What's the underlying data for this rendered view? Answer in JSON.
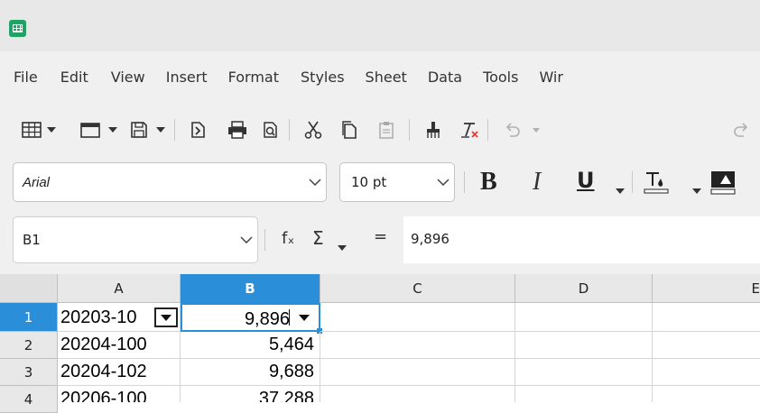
{
  "menu": [
    "File",
    "Edit",
    "View",
    "Insert",
    "Format",
    "Styles",
    "Sheet",
    "Data",
    "Tools",
    "Wir"
  ],
  "toolbar": {
    "icons": [
      "table-icon",
      "new-document-icon",
      "save-icon",
      "open-template-icon",
      "print-icon",
      "print-preview-icon",
      "cut-icon",
      "copy-icon",
      "paste-icon",
      "clone-formatting-icon",
      "clear-formatting-icon",
      "undo-icon",
      "redo-icon"
    ]
  },
  "formatting": {
    "font_name": "Arial",
    "font_size": "10 pt",
    "bold_label": "B",
    "italic_label": "I",
    "underline_label": "U"
  },
  "formula_bar": {
    "name_box": "B1",
    "fx_label": "fₓ",
    "sum_label": "Σ",
    "equals_label": "=",
    "value": "9,896"
  },
  "sheet": {
    "columns": [
      "A",
      "B",
      "C",
      "D",
      "E"
    ],
    "selected_column": "B",
    "rows": [
      {
        "num": "1",
        "a": "20203-10",
        "b": "9,896"
      },
      {
        "num": "2",
        "a": "20204-100",
        "b": "5,464"
      },
      {
        "num": "3",
        "a": "20204-102",
        "b": "9,688"
      },
      {
        "num": "4",
        "a": "20206-100",
        "b": "37,288"
      }
    ]
  },
  "colors": {
    "accent": "#2a8ed9",
    "app_green": "#21a366"
  }
}
